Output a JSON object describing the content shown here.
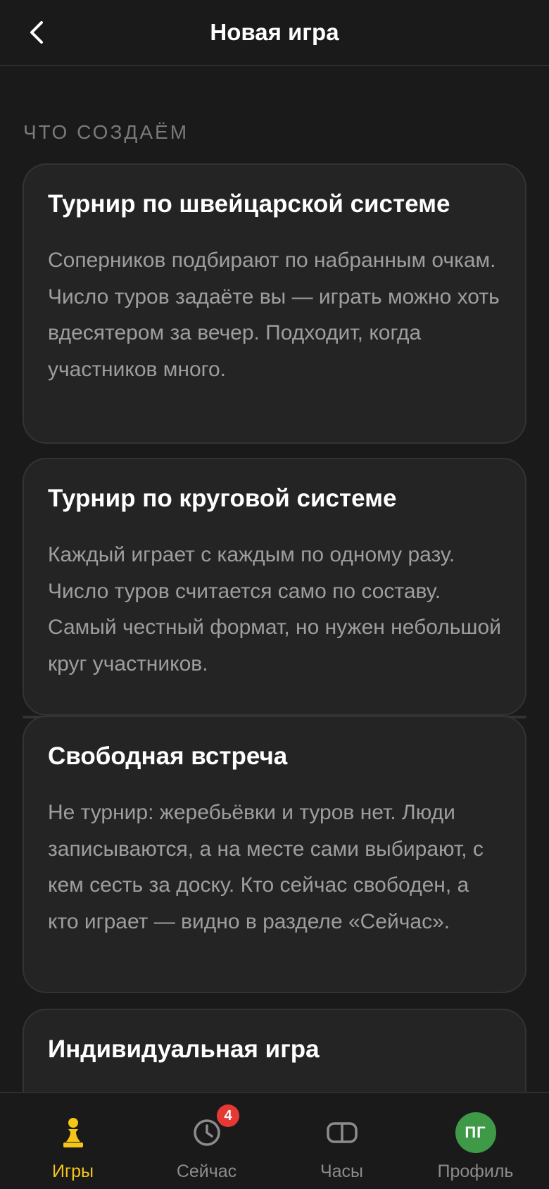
{
  "header": {
    "title": "Новая игра",
    "back_icon": "chevron-left-icon"
  },
  "section": {
    "label": "ЧТО СОЗДАЁМ"
  },
  "cards": [
    {
      "title": "Турнир по швейцарской системе",
      "description": "Соперников подбирают по набранным очкам. Число туров задаёте вы — играть можно хоть вдесятером за вечер. Подходит, когда участников много."
    },
    {
      "title": "Турнир по круговой системе",
      "description": "Каждый играет с каждым по одному разу. Число туров считается само по составу. Самый честный формат, но нужен небольшой круг участников."
    },
    {
      "title": "Свободная встреча",
      "description": "Не турнир: жеребьёвки и туров нет. Люди записываются, а на месте сами выбирают, с кем сесть за доску. Кто сейчас свободен, а кто играет — видно в разделе «Сейчас»."
    },
    {
      "title": "Индивидуальная игра",
      "description": ""
    }
  ],
  "tabbar": {
    "tabs": [
      {
        "label": "Игры",
        "icon": "chess-pawn-icon",
        "active": true
      },
      {
        "label": "Сейчас",
        "icon": "clock-icon",
        "badge": "4"
      },
      {
        "label": "Часы",
        "icon": "chess-clock-icon"
      },
      {
        "label": "Профиль",
        "icon": "avatar",
        "avatar_initials": "ПГ"
      }
    ]
  },
  "colors": {
    "background": "#1a1a1a",
    "card": "#242424",
    "accent": "#f5c518",
    "badge": "#e53935",
    "avatar": "#3e9a47"
  }
}
